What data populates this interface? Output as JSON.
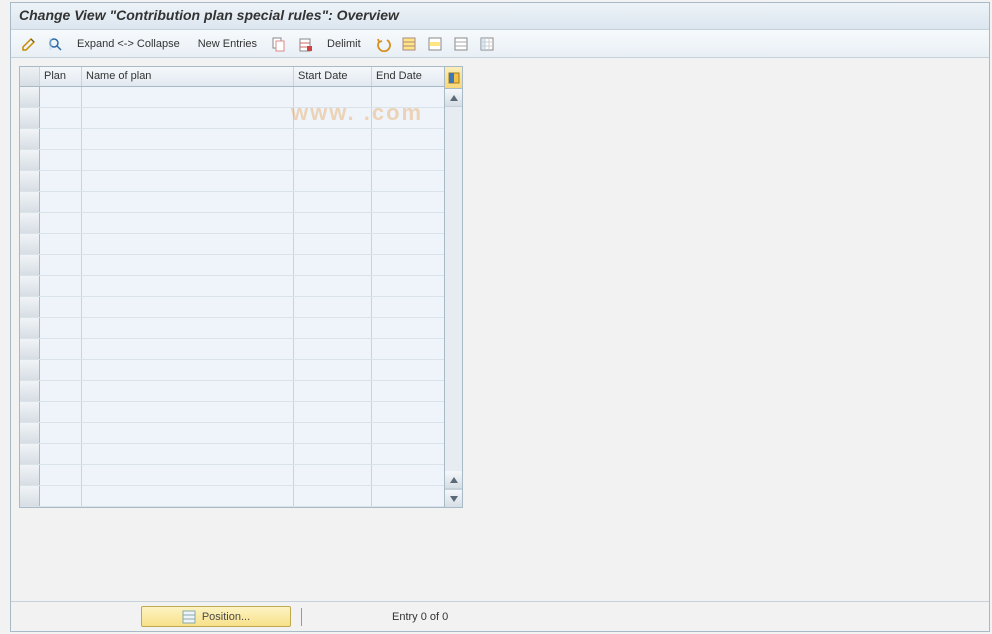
{
  "title": "Change View \"Contribution plan special rules\": Overview",
  "toolbar": {
    "expand_collapse": "Expand <-> Collapse",
    "new_entries": "New Entries",
    "delimit": "Delimit"
  },
  "table": {
    "columns": {
      "plan": "Plan",
      "name": "Name of plan",
      "start": "Start Date",
      "end": "End Date"
    },
    "row_count": 20
  },
  "footer": {
    "position": "Position...",
    "entry": "Entry 0 of 0"
  },
  "watermark": "www.            .com"
}
